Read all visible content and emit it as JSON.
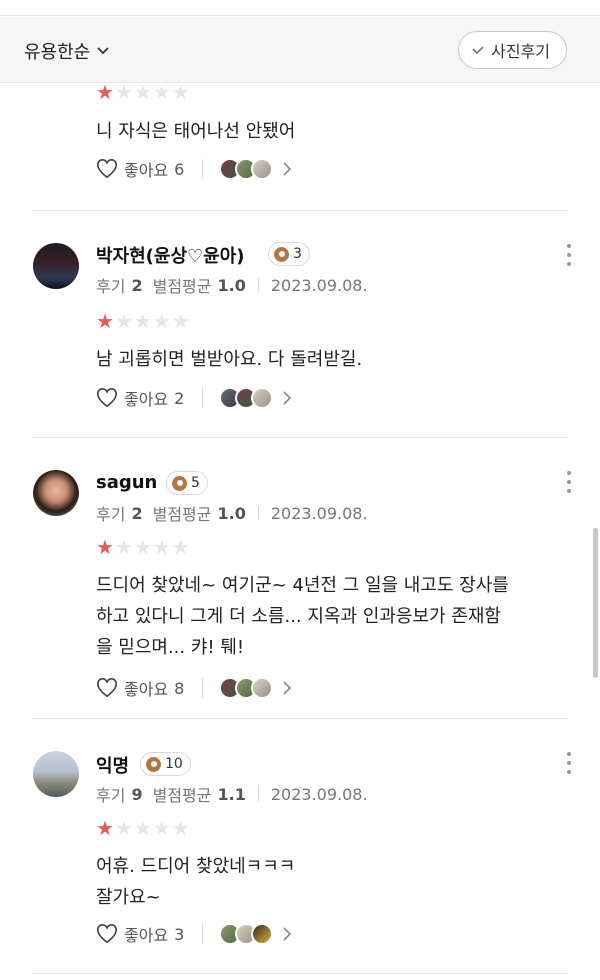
{
  "filter": {
    "sort_label": "유용한순",
    "photo_review_label": "사진후기"
  },
  "labels": {
    "reviews_prefix": "후기",
    "avg_prefix": "별점평균",
    "like_prefix": "좋아요"
  },
  "reviews": [
    {
      "rating": 1,
      "text": "니 자식은 태어나선 안됐어",
      "likes": "6"
    },
    {
      "nickname": "박자현(윤상♡윤아)",
      "badge_level": "3",
      "review_count": "2",
      "avg_rating": "1.0",
      "date": "2023.09.08.",
      "rating": 1,
      "text": "남 괴롭히면 벌받아요. 다 돌려받길.",
      "likes": "2"
    },
    {
      "nickname": "sagun",
      "badge_level": "5",
      "review_count": "2",
      "avg_rating": "1.0",
      "date": "2023.09.08.",
      "rating": 1,
      "text": "드디어 찾았네~ 여기군~ 4년전 그 일을 내고도 장사를\n하고 있다니 그게 더 소름... 지옥과 인과응보가 존재함\n을 믿으며... 캬! 퉤!",
      "likes": "8"
    },
    {
      "nickname": "익명",
      "badge_level": "10",
      "review_count": "9",
      "avg_rating": "1.1",
      "date": "2023.09.08.",
      "rating": 1,
      "text": "어휴. 드디어 찾았네ㅋㅋㅋ\n잘가요~",
      "likes": "3"
    }
  ],
  "stars_glyph": "★★★★★",
  "colors": {
    "star_on": "#e8595b",
    "star_off": "#e5e5e5",
    "badge": "#b4763f"
  }
}
